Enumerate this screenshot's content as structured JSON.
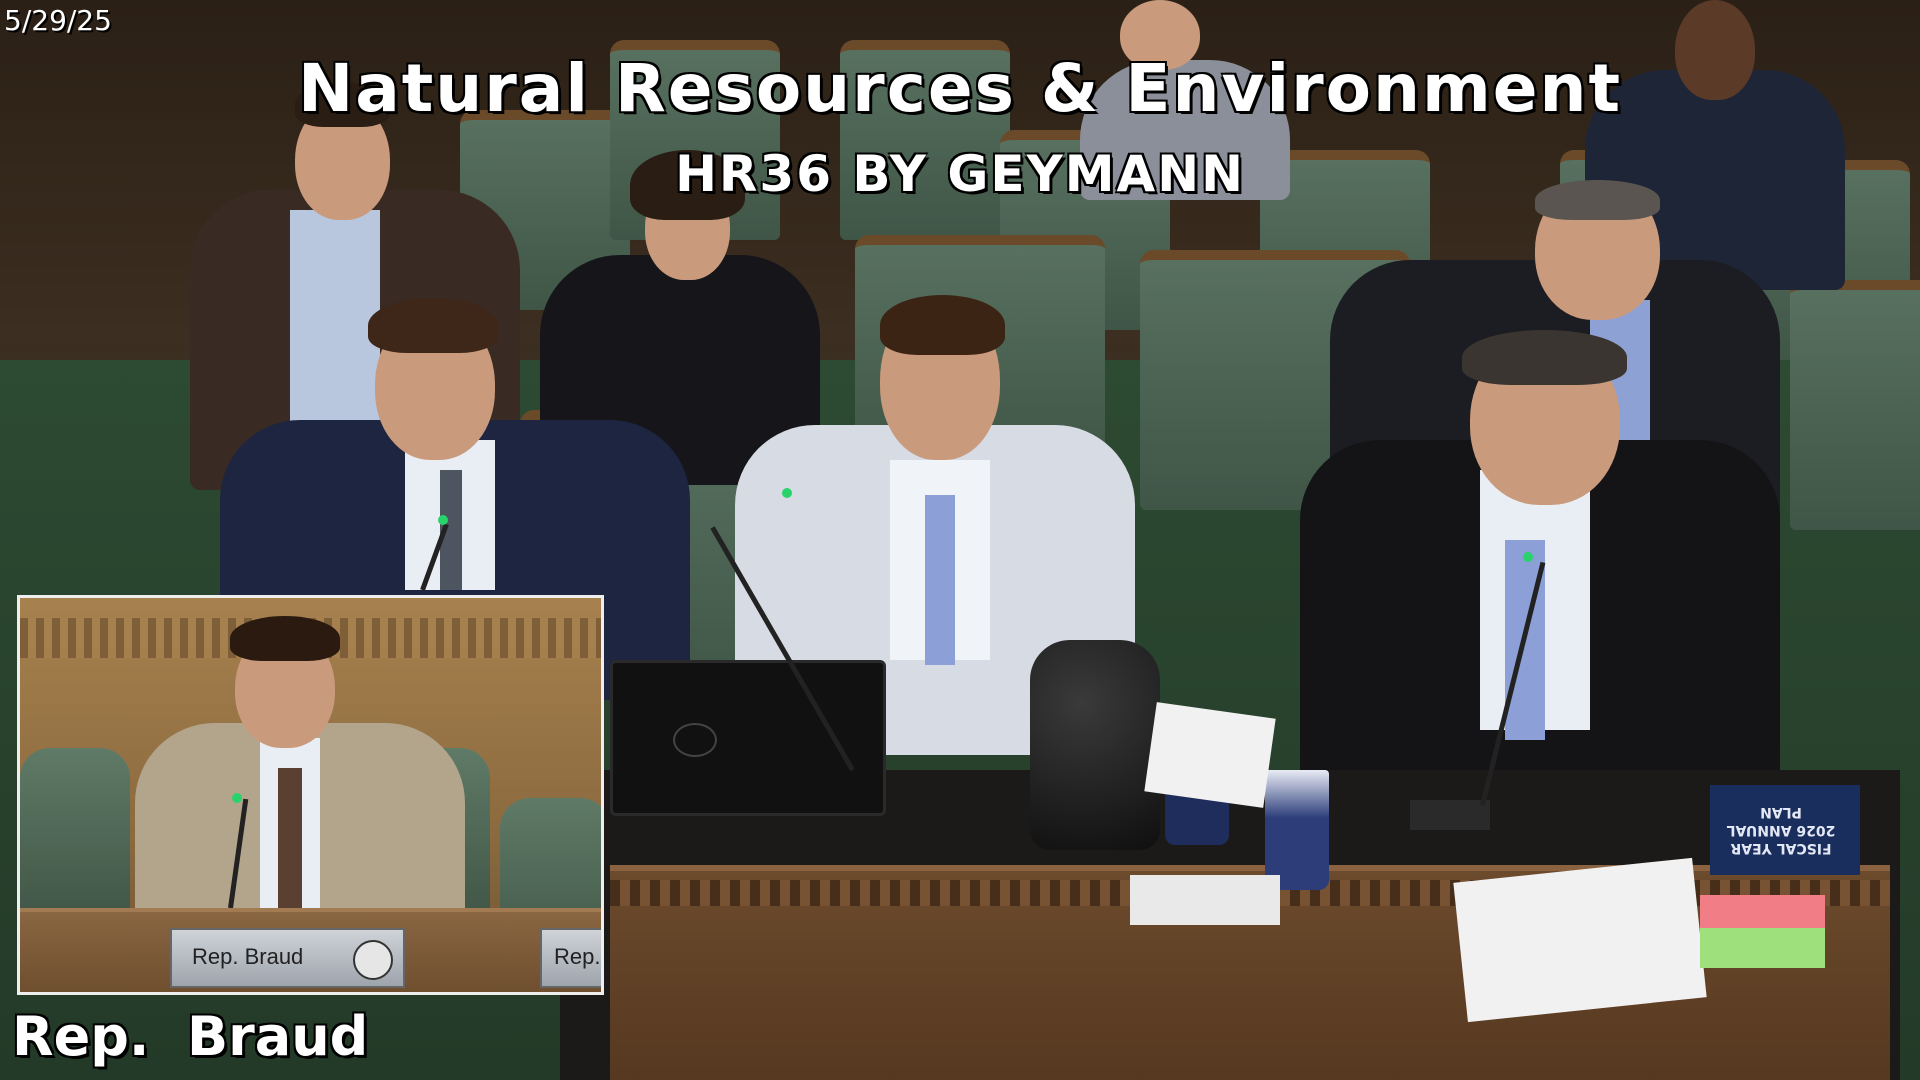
{
  "broadcast": {
    "date": "5/29/25",
    "committee_title": "Natural Resources & Environment",
    "bill_title": "HR36 BY GEYMANN",
    "speaker_caption": "Rep.  Braud"
  },
  "inset": {
    "nameplate": "Rep. Braud",
    "nameplate_partial": "Rep."
  },
  "desk_items": {
    "report_text": "FISCAL YEAR 2026 ANNUAL PLAN"
  }
}
